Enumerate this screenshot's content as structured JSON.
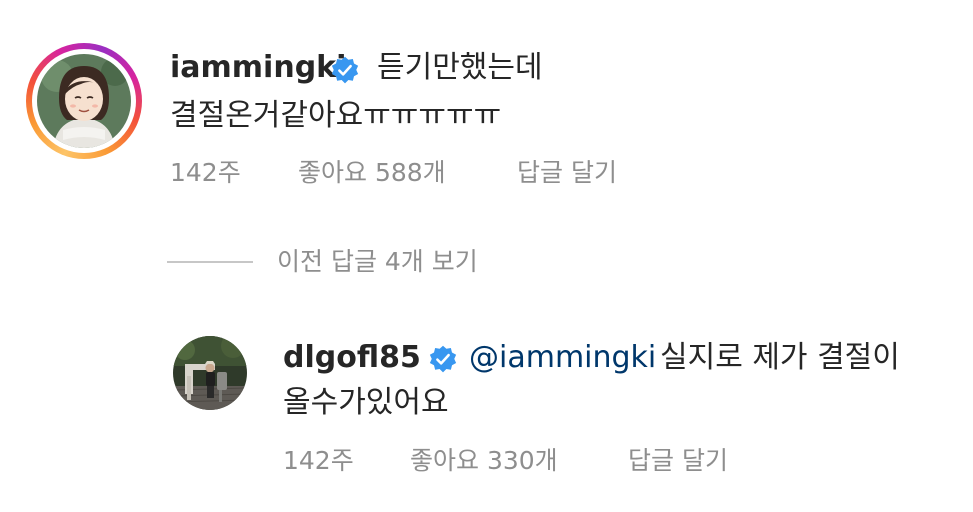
{
  "comment": {
    "username": "iammingki",
    "text_line1": "듣기만했는데",
    "text_line2": "결절온거같아요ㅠㅠㅠㅠㅠ",
    "time": "142주",
    "likes": "좋아요 588개",
    "reply_label": "답글 달기"
  },
  "view_previous_replies": "이전 답글 4개 보기",
  "reply": {
    "username": "dlgofl85",
    "mention": "@iammingki",
    "text_line1": "실지로 제가 결절이",
    "text_line2": "올수가있어요",
    "time": "142주",
    "likes": "좋아요 330개",
    "reply_label": "답글 달기"
  },
  "colors": {
    "verified": "#3897f0",
    "mention": "#00376b",
    "meta": "#8e8e8e"
  }
}
